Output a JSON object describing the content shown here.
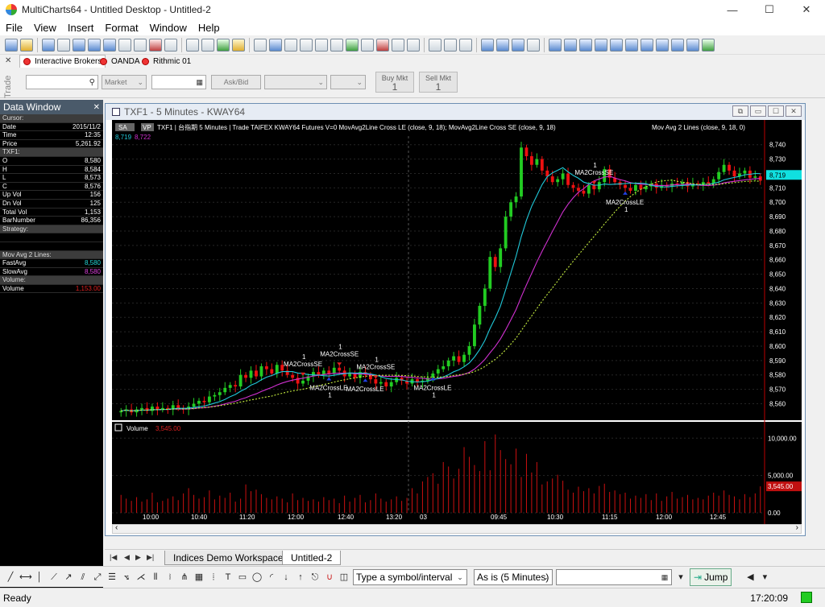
{
  "window": {
    "title": "MultiCharts64 - Untitled Desktop - Untitled-2",
    "min": "—",
    "max": "☐",
    "close": "✕"
  },
  "menu": [
    "File",
    "View",
    "Insert",
    "Format",
    "Window",
    "Help"
  ],
  "trade": {
    "side_label": "Trade",
    "broker_tabs": [
      "Interactive Brokers",
      "OANDA",
      "Rithmic 01"
    ],
    "order_type": "Market",
    "ask_bid": "Ask/Bid",
    "buy_label": "Buy Mkt",
    "buy_qty": "1",
    "sell_label": "Sell Mkt",
    "sell_qty": "1"
  },
  "data_window": {
    "title": "Data Window",
    "rows": [
      {
        "k": "Cursor:",
        "v": "",
        "sec": true
      },
      {
        "k": "Date",
        "v": "2015/11/2"
      },
      {
        "k": "Time",
        "v": "12:35"
      },
      {
        "k": "Price",
        "v": "5,261.92"
      },
      {
        "k": "TXF1:",
        "v": "",
        "sec": true
      },
      {
        "k": "O",
        "v": "8,580"
      },
      {
        "k": "H",
        "v": "8,584"
      },
      {
        "k": "L",
        "v": "8,573"
      },
      {
        "k": "C",
        "v": "8,576"
      },
      {
        "k": "Up Vol",
        "v": "156"
      },
      {
        "k": "Dn Vol",
        "v": "125"
      },
      {
        "k": "Total Vol",
        "v": "1,153"
      },
      {
        "k": "BarNumber",
        "v": "86,356"
      },
      {
        "k": "Strategy:",
        "v": "",
        "sec": true
      },
      {
        "k": "",
        "v": ""
      },
      {
        "k": "",
        "v": ""
      },
      {
        "k": "Mov Avg 2 Lines:",
        "v": "",
        "sec": true
      },
      {
        "k": "FastAvg",
        "v": "8,580",
        "c": "cyan"
      },
      {
        "k": "SlowAvg",
        "v": "8,580",
        "c": "mag"
      },
      {
        "k": "Volume:",
        "v": "",
        "sec": true
      },
      {
        "k": "Volume",
        "v": "1,153.00",
        "c": "red"
      }
    ]
  },
  "chart_window": {
    "title": "TXF1 - 5 Minutes - KWAY64",
    "header": "TXF1  |  台指期  5 Minutes  |  Trade  TAIFEX  KWAY64  Futures  V=0  MovAvg2Line Cross LE (close, 9, 18); MovAvg2Line Cross SE (close, 9, 18)",
    "header_ma": "Mov Avg 2 Lines   (close, 9, 18, 0)",
    "sa": "SA",
    "vp": "VP",
    "fast_val": "8,719",
    "slow_val": "8,722",
    "volume_label": "Volume",
    "volume_val": "3,545.00",
    "last_price": "8,719",
    "last_volume": "3,545.00"
  },
  "chart_data": {
    "type": "candlestick",
    "price_axis": [
      "8,740",
      "8,730",
      "8,720",
      "8,710",
      "8,700",
      "8,690",
      "8,680",
      "8,670",
      "8,660",
      "8,650",
      "8,640",
      "8,630",
      "8,620",
      "8,610",
      "8,600",
      "8,590",
      "8,580",
      "8,570",
      "8,560"
    ],
    "ylim": [
      8553,
      8746
    ],
    "volume_axis": [
      "10,000.00",
      "5,000.00",
      "0.00"
    ],
    "volume_ylim": [
      0,
      11000
    ],
    "time_labels": [
      "10:00",
      "10:40",
      "11:20",
      "12:00",
      "12:40",
      "13:20",
      "03",
      "09:45",
      "10:30",
      "11:15",
      "12:00",
      "12:45"
    ],
    "closes": [
      8555,
      8556,
      8554,
      8556,
      8557,
      8555,
      8558,
      8556,
      8557,
      8556,
      8559,
      8557,
      8556,
      8558,
      8560,
      8562,
      8561,
      8565,
      8566,
      8568,
      8571,
      8573,
      8572,
      8580,
      8578,
      8583,
      8579,
      8586,
      8584,
      8581,
      8587,
      8583,
      8580,
      8578,
      8574,
      8576,
      8579,
      8582,
      8580,
      8583,
      8581,
      8585,
      8583,
      8579,
      8581,
      8578,
      8582,
      8580,
      8577,
      8574,
      8575,
      8572,
      8575,
      8578,
      8576,
      8574,
      8577,
      8575,
      8576,
      8578,
      8581,
      8584,
      8586,
      8590,
      8593,
      8589,
      8594,
      8600,
      8615,
      8628,
      8640,
      8662,
      8655,
      8668,
      8690,
      8700,
      8704,
      8738,
      8732,
      8726,
      8730,
      8722,
      8718,
      8714,
      8716,
      8720,
      8712,
      8710,
      8708,
      8706,
      8712,
      8709,
      8714,
      8723,
      8717,
      8714,
      8712,
      8710,
      8708,
      8712,
      8709,
      8711,
      8713,
      8710,
      8712,
      8711,
      8713,
      8712,
      8714,
      8711,
      8713,
      8712,
      8714,
      8713,
      8716,
      8721,
      8726,
      8722,
      8718,
      8720,
      8722,
      8717,
      8718,
      8715
    ],
    "volumes": [
      2400,
      1900,
      1600,
      2100,
      1500,
      1800,
      2700,
      1400,
      1600,
      1900,
      2200,
      1700,
      2600,
      3300,
      2400,
      1900,
      2100,
      3000,
      1800,
      2300,
      2000,
      2700,
      1500,
      1900,
      3800,
      2900,
      3100,
      2500,
      2000,
      1800,
      2200,
      1900,
      1400,
      2600,
      1700,
      2000,
      1600,
      1800,
      1500,
      2100,
      1700,
      1900,
      1300,
      2300,
      1500,
      2000,
      2400,
      1400,
      1700,
      2600,
      1900,
      1500,
      1800,
      2200,
      1600,
      2000,
      3300,
      2600,
      4200,
      4800,
      5300,
      3900,
      6800,
      6200,
      4600,
      5900,
      8800,
      7500,
      6400,
      5600,
      9600,
      5700,
      10500,
      8400,
      7200,
      6500,
      8600,
      4800,
      7900,
      5400,
      6800,
      3800,
      4200,
      4600,
      5100,
      4300,
      3100,
      2700,
      3500,
      2900,
      3300,
      2600,
      3600,
      3900,
      2800,
      3000,
      2500,
      2700,
      1900,
      2300,
      2000,
      2500,
      1700,
      2600,
      1600,
      2200,
      2800,
      1900,
      2100,
      2400,
      1800,
      2000,
      1800,
      2300,
      2700,
      2300,
      3000,
      2400,
      2200,
      1800,
      2500,
      2100,
      2600,
      3545
    ],
    "annotations": [
      {
        "label": "MA2CrossSE",
        "qty": "1",
        "bar": 35,
        "kind": "SE"
      },
      {
        "label": "MA2CrossSE",
        "qty": "1",
        "bar": 42,
        "kind": "SE"
      },
      {
        "label": "MA2CrossSE",
        "qty": "1",
        "bar": 49,
        "kind": "SE"
      },
      {
        "label": "MA2CrossLE",
        "qty": "1",
        "bar": 40,
        "kind": "LE"
      },
      {
        "label": "MA2CrossLE",
        "qty": "",
        "bar": 47,
        "kind": "LE"
      },
      {
        "label": "MA2CrossLE",
        "qty": "1",
        "bar": 60,
        "kind": "LE"
      },
      {
        "label": "MA2CrossSE",
        "qty": "1",
        "bar": 91,
        "kind": "SE"
      },
      {
        "label": "MA2CrossLE",
        "qty": "1",
        "bar": 97,
        "kind": "LE"
      }
    ],
    "colors": {
      "up": "#22cc22",
      "down": "#ee1111",
      "fast": "#20c8d8",
      "slow": "#d030d0",
      "dotted": "#c8f040",
      "volume": "#cc1010"
    }
  },
  "workspace_tabs": [
    "Indices Demo Workspace",
    "Untitled-2"
  ],
  "drawbar": {
    "symbol_placeholder": "Type a symbol/interval",
    "resolution": "As is (5 Minutes)",
    "jump": "Jump"
  },
  "status": {
    "text": "Ready",
    "clock": "17:20:09"
  }
}
